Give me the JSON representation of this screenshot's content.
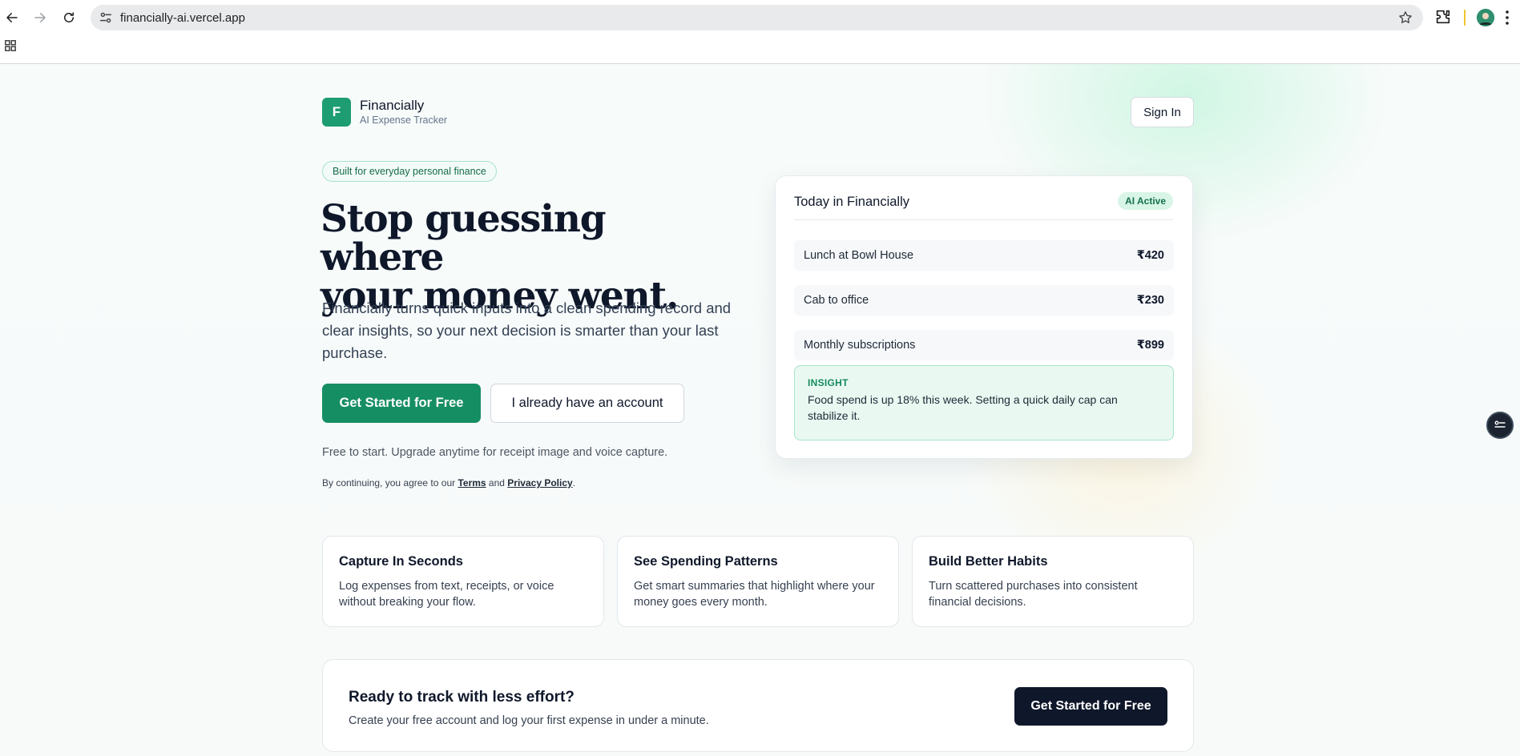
{
  "browser": {
    "url": "financially-ai.vercel.app"
  },
  "brand": {
    "logo_letter": "F",
    "name": "Financially",
    "subtitle": "AI Expense Tracker"
  },
  "header": {
    "sign_in_label": "Sign In"
  },
  "hero": {
    "tagline": "Built for everyday personal finance",
    "headline_line1": "Stop guessing where",
    "headline_line2": "your money went.",
    "lead": "Financially turns quick inputs into a clean spending record and clear insights, so your next decision is smarter than your last purchase.",
    "primary_cta": "Get Started for Free",
    "secondary_cta": "I already have an account",
    "free_note": "Free to start. Upgrade anytime for receipt image and voice capture.",
    "legal_prefix": "By continuing, you agree to our ",
    "legal_terms": "Terms",
    "legal_and": " and ",
    "legal_privacy": "Privacy Policy",
    "legal_suffix": "."
  },
  "preview": {
    "title": "Today in Financially",
    "badge": "AI Active",
    "transactions": [
      {
        "name": "Lunch at Bowl House",
        "amount": "₹420"
      },
      {
        "name": "Cab to office",
        "amount": "₹230"
      },
      {
        "name": "Monthly subscriptions",
        "amount": "₹899"
      }
    ],
    "insight_label": "INSIGHT",
    "insight_text": "Food spend is up 18% this week. Setting a quick daily cap can stabilize it."
  },
  "features": [
    {
      "title": "Capture In Seconds",
      "desc": "Log expenses from text, receipts, or voice without breaking your flow."
    },
    {
      "title": "See Spending Patterns",
      "desc": "Get smart summaries that highlight where your money goes every month."
    },
    {
      "title": "Build Better Habits",
      "desc": "Turn scattered purchases into consistent financial decisions."
    }
  ],
  "cta": {
    "title": "Ready to track with less effort?",
    "desc": "Create your free account and log your first expense in under a minute.",
    "button": "Get Started for Free"
  },
  "colors": {
    "brand_green": "#1e9c72",
    "primary_button": "#168e64",
    "dark_button": "#0f172a",
    "insight_bg": "#e9f9f1"
  }
}
